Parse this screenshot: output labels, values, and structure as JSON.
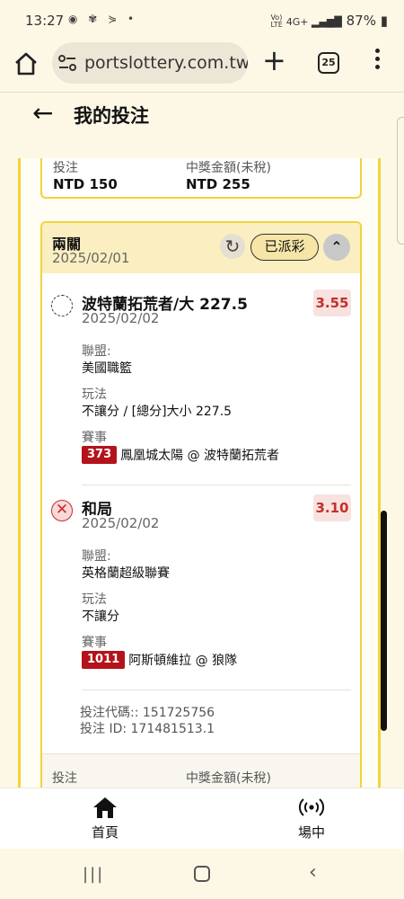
{
  "status_bar": {
    "time": "13:27",
    "network": "VoLTE 4G+",
    "battery": "87%"
  },
  "browser": {
    "url": "portslottery.com.tw",
    "tab_count": "25"
  },
  "page": {
    "title": "我的投注"
  },
  "previous_bet": {
    "stake_label": "投注",
    "stake_value": "NTD 150",
    "payout_label": "中獎金額(未稅)",
    "payout_value": "NTD 255"
  },
  "combo_bet": {
    "type": "兩關",
    "date": "2025/02/01",
    "status": "已派彩",
    "selections": [
      {
        "result": "pending",
        "pick": "波特蘭拓荒者/大 227.5",
        "date": "2025/02/02",
        "odds": "3.55",
        "league_label": "聯盟:",
        "league": "美國職籃",
        "market_label": "玩法",
        "market": "不讓分 / [總分]大小 227.5",
        "event_label": "賽事",
        "event_number": "373",
        "event": "鳳凰城太陽 @ 波特蘭拓荒者"
      },
      {
        "result": "lost",
        "pick": "和局",
        "date": "2025/02/02",
        "odds": "3.10",
        "league_label": "聯盟:",
        "league": "英格蘭超級聯賽",
        "market_label": "玩法",
        "market": "不讓分",
        "event_label": "賽事",
        "event_number": "1011",
        "event": "阿斯頓維拉 @ 狼隊"
      }
    ],
    "bet_code": "投注代碼:: 151725756",
    "bet_id": "投注 ID: 171481513.1",
    "footer_stake_label": "投注",
    "footer_payout_label": "中獎金額(未稅)"
  },
  "bottom_nav": {
    "home": "首頁",
    "live": "場中"
  },
  "colors": {
    "accent_yellow": "#f2d33a",
    "header_bg": "#fbeec0",
    "odds_red": "#c2302b",
    "event_badge": "#b4131b"
  }
}
